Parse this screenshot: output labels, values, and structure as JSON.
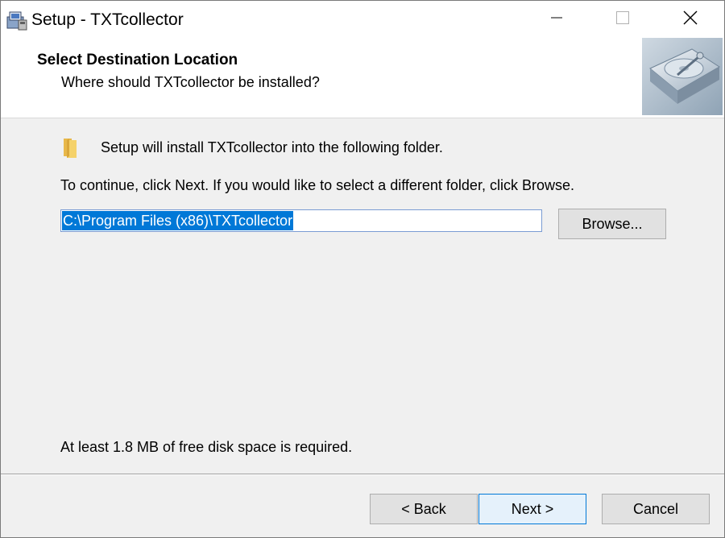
{
  "window": {
    "title": "Setup - TXTcollector",
    "icon": "setup-installer-icon"
  },
  "titlebar": {
    "minimize_icon": "minimize-icon",
    "maximize_icon": "maximize-icon",
    "close_icon": "close-icon"
  },
  "header": {
    "title": "Select Destination Location",
    "subtitle": "Where should TXTcollector be installed?",
    "image": "hard-disk-wizard-image"
  },
  "body": {
    "folder_icon": "folder-icon",
    "install_text": "Setup will install TXTcollector into the following folder.",
    "continue_text": "To continue, click Next. If you would like to select a different folder, click Browse.",
    "path_value": "C:\\Program Files (x86)\\TXTcollector",
    "browse_label": "Browse...",
    "disk_space_text": "At least 1.8 MB of free disk space is required."
  },
  "footer": {
    "back_label": "< Back",
    "next_label": "Next >",
    "cancel_label": "Cancel"
  },
  "colors": {
    "selection": "#0078d7",
    "button_face": "#e1e1e1",
    "default_button_border": "#0078d7",
    "panel_background": "#f0f0f0"
  }
}
